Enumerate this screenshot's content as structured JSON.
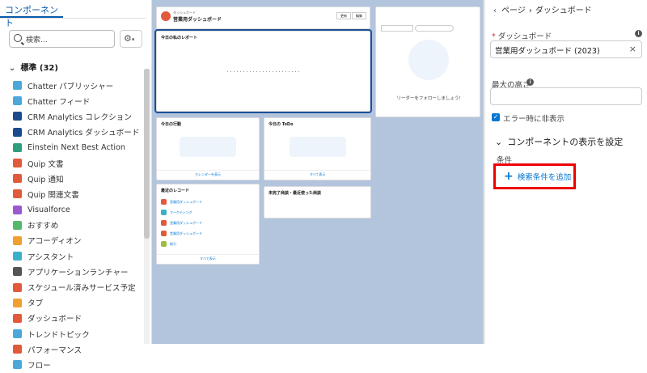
{
  "left": {
    "header": "コンポーネント",
    "search_placeholder": "検索...",
    "section": "標準 (32)",
    "items": [
      {
        "label": "Chatter パブリッシャー",
        "color": "#4ba8d8"
      },
      {
        "label": "Chatter フィード",
        "color": "#4ba8d8"
      },
      {
        "label": "CRM Analytics コレクション",
        "color": "#1c4b8d"
      },
      {
        "label": "CRM Analytics ダッシュボード",
        "color": "#1c4b8d"
      },
      {
        "label": "Einstein Next Best Action",
        "color": "#2e9e7c"
      },
      {
        "label": "Quip 文書",
        "color": "#e25a3c"
      },
      {
        "label": "Quip 通知",
        "color": "#e25a3c"
      },
      {
        "label": "Quip 関連文書",
        "color": "#e25a3c"
      },
      {
        "label": "Visualforce",
        "color": "#9b59d0"
      },
      {
        "label": "おすすめ",
        "color": "#56b86c"
      },
      {
        "label": "アコーディオン",
        "color": "#f0a030"
      },
      {
        "label": "アシスタント",
        "color": "#3cb0c9"
      },
      {
        "label": "アプリケーションランチャー",
        "color": "#555555"
      },
      {
        "label": "スケジュール済みサービス予定",
        "color": "#e25a3c"
      },
      {
        "label": "タブ",
        "color": "#f0a030"
      },
      {
        "label": "ダッシュボード",
        "color": "#e25a3c"
      },
      {
        "label": "トレンドトピック",
        "color": "#4ba8d8"
      },
      {
        "label": "パフォーマンス",
        "color": "#e25a3c"
      },
      {
        "label": "フロー",
        "color": "#4ba8d8"
      }
    ]
  },
  "canvas": {
    "dashboard_title": "営業用ダッシュボード",
    "dashboard_sub": "ダッシュボード",
    "btn1": "更新",
    "btn2": "編集",
    "today_report": "今日の私のレポート",
    "follow_title": "リーダーをフォローしましょう!",
    "today_events": "今日の行動",
    "today_todo": "今日の ToDo",
    "recent_records": "最近のレコード",
    "tasks_box": "未完了商談・最近使った商談",
    "view_calendar": "カレンダーを表示",
    "view_all": "すべて表示",
    "recent_items": [
      "営業用ダッシュボード",
      "マーケティング",
      "営業用ダッシュボード",
      "営業用ダッシュボード",
      "取引"
    ]
  },
  "right": {
    "breadcrumb_page": "ページ",
    "breadcrumb_current": "ダッシュボード",
    "dashboard_label": "ダッシュボード",
    "dashboard_value": "営業用ダッシュボード (2023)",
    "max_height_label": "最大の高さ",
    "hide_on_error": "エラー時に非表示",
    "visibility_title": "コンポーネントの表示を設定",
    "conditions_label": "条件",
    "add_condition": "検索条件を追加"
  }
}
